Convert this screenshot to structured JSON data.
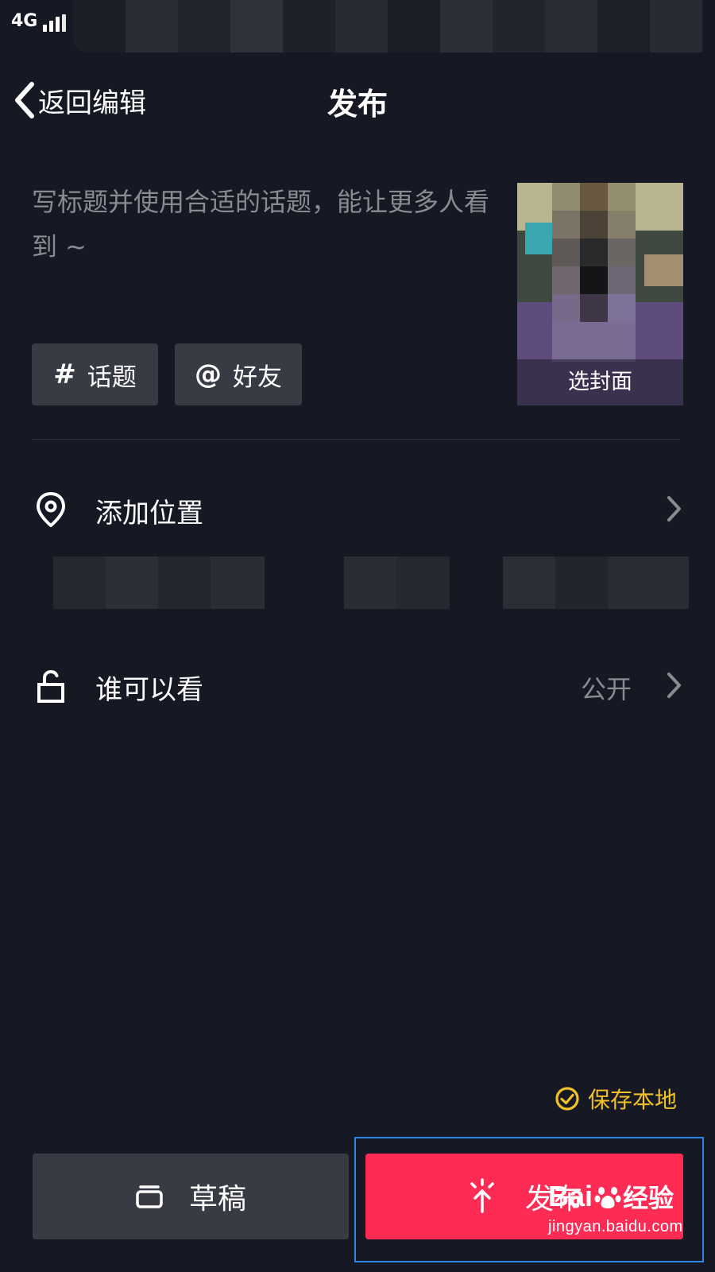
{
  "status_bar": {
    "network": "4G"
  },
  "header": {
    "back_label": "返回编辑",
    "title": "发布"
  },
  "caption": {
    "placeholder": "写标题并使用合适的话题，能让更多人看到 ~"
  },
  "cover": {
    "label": "选封面"
  },
  "chips": [
    {
      "symbol": "#",
      "label": "话题"
    },
    {
      "symbol": "@",
      "label": "好友"
    }
  ],
  "location": {
    "label": "添加位置"
  },
  "visibility": {
    "label": "谁可以看",
    "value": "公开"
  },
  "save_local": {
    "label": "保存本地",
    "checked": true
  },
  "actions": {
    "draft_label": "草稿",
    "publish_label": "发布"
  },
  "watermark": {
    "brand_left": "Bai",
    "brand_right": "经验",
    "url": "jingyan.baidu.com"
  },
  "colors": {
    "background": "#161823",
    "accent": "#fe2c55",
    "save_local": "#f2c027",
    "chip": "#393b44",
    "highlight": "#2f86e6"
  }
}
